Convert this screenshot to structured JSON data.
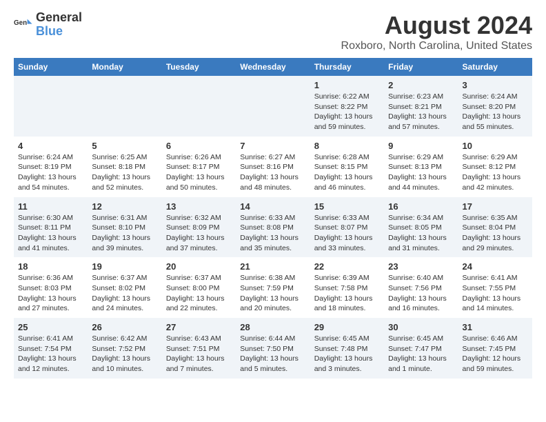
{
  "logo": {
    "line1": "General",
    "line2": "Blue"
  },
  "title": "August 2024",
  "subtitle": "Roxboro, North Carolina, United States",
  "weekdays": [
    "Sunday",
    "Monday",
    "Tuesday",
    "Wednesday",
    "Thursday",
    "Friday",
    "Saturday"
  ],
  "weeks": [
    [
      {
        "day": "",
        "info": ""
      },
      {
        "day": "",
        "info": ""
      },
      {
        "day": "",
        "info": ""
      },
      {
        "day": "",
        "info": ""
      },
      {
        "day": "1",
        "info": "Sunrise: 6:22 AM\nSunset: 8:22 PM\nDaylight: 13 hours\nand 59 minutes."
      },
      {
        "day": "2",
        "info": "Sunrise: 6:23 AM\nSunset: 8:21 PM\nDaylight: 13 hours\nand 57 minutes."
      },
      {
        "day": "3",
        "info": "Sunrise: 6:24 AM\nSunset: 8:20 PM\nDaylight: 13 hours\nand 55 minutes."
      }
    ],
    [
      {
        "day": "4",
        "info": "Sunrise: 6:24 AM\nSunset: 8:19 PM\nDaylight: 13 hours\nand 54 minutes."
      },
      {
        "day": "5",
        "info": "Sunrise: 6:25 AM\nSunset: 8:18 PM\nDaylight: 13 hours\nand 52 minutes."
      },
      {
        "day": "6",
        "info": "Sunrise: 6:26 AM\nSunset: 8:17 PM\nDaylight: 13 hours\nand 50 minutes."
      },
      {
        "day": "7",
        "info": "Sunrise: 6:27 AM\nSunset: 8:16 PM\nDaylight: 13 hours\nand 48 minutes."
      },
      {
        "day": "8",
        "info": "Sunrise: 6:28 AM\nSunset: 8:15 PM\nDaylight: 13 hours\nand 46 minutes."
      },
      {
        "day": "9",
        "info": "Sunrise: 6:29 AM\nSunset: 8:13 PM\nDaylight: 13 hours\nand 44 minutes."
      },
      {
        "day": "10",
        "info": "Sunrise: 6:29 AM\nSunset: 8:12 PM\nDaylight: 13 hours\nand 42 minutes."
      }
    ],
    [
      {
        "day": "11",
        "info": "Sunrise: 6:30 AM\nSunset: 8:11 PM\nDaylight: 13 hours\nand 41 minutes."
      },
      {
        "day": "12",
        "info": "Sunrise: 6:31 AM\nSunset: 8:10 PM\nDaylight: 13 hours\nand 39 minutes."
      },
      {
        "day": "13",
        "info": "Sunrise: 6:32 AM\nSunset: 8:09 PM\nDaylight: 13 hours\nand 37 minutes."
      },
      {
        "day": "14",
        "info": "Sunrise: 6:33 AM\nSunset: 8:08 PM\nDaylight: 13 hours\nand 35 minutes."
      },
      {
        "day": "15",
        "info": "Sunrise: 6:33 AM\nSunset: 8:07 PM\nDaylight: 13 hours\nand 33 minutes."
      },
      {
        "day": "16",
        "info": "Sunrise: 6:34 AM\nSunset: 8:05 PM\nDaylight: 13 hours\nand 31 minutes."
      },
      {
        "day": "17",
        "info": "Sunrise: 6:35 AM\nSunset: 8:04 PM\nDaylight: 13 hours\nand 29 minutes."
      }
    ],
    [
      {
        "day": "18",
        "info": "Sunrise: 6:36 AM\nSunset: 8:03 PM\nDaylight: 13 hours\nand 27 minutes."
      },
      {
        "day": "19",
        "info": "Sunrise: 6:37 AM\nSunset: 8:02 PM\nDaylight: 13 hours\nand 24 minutes."
      },
      {
        "day": "20",
        "info": "Sunrise: 6:37 AM\nSunset: 8:00 PM\nDaylight: 13 hours\nand 22 minutes."
      },
      {
        "day": "21",
        "info": "Sunrise: 6:38 AM\nSunset: 7:59 PM\nDaylight: 13 hours\nand 20 minutes."
      },
      {
        "day": "22",
        "info": "Sunrise: 6:39 AM\nSunset: 7:58 PM\nDaylight: 13 hours\nand 18 minutes."
      },
      {
        "day": "23",
        "info": "Sunrise: 6:40 AM\nSunset: 7:56 PM\nDaylight: 13 hours\nand 16 minutes."
      },
      {
        "day": "24",
        "info": "Sunrise: 6:41 AM\nSunset: 7:55 PM\nDaylight: 13 hours\nand 14 minutes."
      }
    ],
    [
      {
        "day": "25",
        "info": "Sunrise: 6:41 AM\nSunset: 7:54 PM\nDaylight: 13 hours\nand 12 minutes."
      },
      {
        "day": "26",
        "info": "Sunrise: 6:42 AM\nSunset: 7:52 PM\nDaylight: 13 hours\nand 10 minutes."
      },
      {
        "day": "27",
        "info": "Sunrise: 6:43 AM\nSunset: 7:51 PM\nDaylight: 13 hours\nand 7 minutes."
      },
      {
        "day": "28",
        "info": "Sunrise: 6:44 AM\nSunset: 7:50 PM\nDaylight: 13 hours\nand 5 minutes."
      },
      {
        "day": "29",
        "info": "Sunrise: 6:45 AM\nSunset: 7:48 PM\nDaylight: 13 hours\nand 3 minutes."
      },
      {
        "day": "30",
        "info": "Sunrise: 6:45 AM\nSunset: 7:47 PM\nDaylight: 13 hours\nand 1 minute."
      },
      {
        "day": "31",
        "info": "Sunrise: 6:46 AM\nSunset: 7:45 PM\nDaylight: 12 hours\nand 59 minutes."
      }
    ]
  ]
}
